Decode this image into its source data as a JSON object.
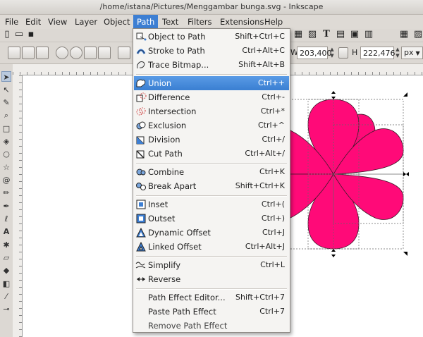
{
  "window": {
    "title": "/home/istana/Pictures/Menggambar bunga.svg - Inkscape"
  },
  "menubar": {
    "items": [
      "File",
      "Edit",
      "View",
      "Layer",
      "Object",
      "Path",
      "Text",
      "Filters",
      "Extensions",
      "Help"
    ],
    "active": "Path"
  },
  "toolbar": {
    "w_label": "W",
    "w_value": "203,400",
    "h_label": "H",
    "h_value": "222,476",
    "unit": "px"
  },
  "path_menu": {
    "items": [
      {
        "label": "Object to Path",
        "shortcut": "Shift+Ctrl+C",
        "icon": "object-to-path-icon"
      },
      {
        "label": "Stroke to Path",
        "shortcut": "Ctrl+Alt+C",
        "icon": "stroke-to-path-icon"
      },
      {
        "label": "Trace Bitmap...",
        "shortcut": "Shift+Alt+B",
        "icon": "trace-bitmap-icon"
      },
      {
        "label": "Union",
        "shortcut": "Ctrl++",
        "icon": "union-icon",
        "highlighted": true
      },
      {
        "label": "Difference",
        "shortcut": "Ctrl+-",
        "icon": "difference-icon"
      },
      {
        "label": "Intersection",
        "shortcut": "Ctrl+*",
        "icon": "intersection-icon"
      },
      {
        "label": "Exclusion",
        "shortcut": "Ctrl+^",
        "icon": "exclusion-icon"
      },
      {
        "label": "Division",
        "shortcut": "Ctrl+/",
        "icon": "division-icon"
      },
      {
        "label": "Cut Path",
        "shortcut": "Ctrl+Alt+/",
        "icon": "cut-path-icon"
      },
      {
        "label": "Combine",
        "shortcut": "Ctrl+K",
        "icon": "combine-icon"
      },
      {
        "label": "Break Apart",
        "shortcut": "Shift+Ctrl+K",
        "icon": "break-apart-icon"
      },
      {
        "label": "Inset",
        "shortcut": "Ctrl+(",
        "icon": "inset-icon"
      },
      {
        "label": "Outset",
        "shortcut": "Ctrl+)",
        "icon": "outset-icon"
      },
      {
        "label": "Dynamic Offset",
        "shortcut": "Ctrl+J",
        "icon": "dynamic-offset-icon"
      },
      {
        "label": "Linked Offset",
        "shortcut": "Ctrl+Alt+J",
        "icon": "linked-offset-icon"
      },
      {
        "label": "Simplify",
        "shortcut": "Ctrl+L",
        "icon": "simplify-icon"
      },
      {
        "label": "Reverse",
        "shortcut": "",
        "icon": "reverse-icon"
      },
      {
        "label": "Path Effect Editor...",
        "shortcut": "Shift+Ctrl+7",
        "icon": ""
      },
      {
        "label": "Paste Path Effect",
        "shortcut": "Ctrl+7",
        "icon": ""
      },
      {
        "label": "Remove Path Effect",
        "shortcut": "",
        "icon": ""
      }
    ]
  },
  "colors": {
    "accent": "#3d7fd3",
    "petal_fill": "#ff0a78"
  }
}
